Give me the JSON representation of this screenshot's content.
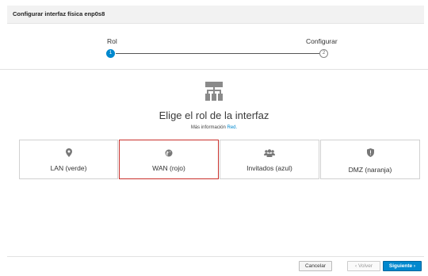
{
  "header": {
    "title": "Configurar interfaz física enp0s8"
  },
  "wizard": {
    "steps": [
      {
        "label": "Rol",
        "number": "1",
        "state": "active"
      },
      {
        "label": "Configurar",
        "number": "2",
        "state": "pending"
      }
    ]
  },
  "main": {
    "title": "Elige el rol de la interfaz",
    "more_info_text": "Más información ",
    "more_info_link": "Red."
  },
  "roles": [
    {
      "label": "LAN (verde)",
      "icon": "map-marker-icon"
    },
    {
      "label": "WAN (rojo)",
      "icon": "globe-icon",
      "selected": true
    },
    {
      "label": "Invitados (azul)",
      "icon": "users-icon"
    },
    {
      "label": "DMZ (naranja)",
      "icon": "shield-icon"
    }
  ],
  "footer": {
    "cancel": "Cancelar",
    "back": "‹  Volver",
    "next": "Siguiente  ›"
  },
  "colors": {
    "accent": "#0088ce",
    "selected_border": "#c9302c"
  }
}
